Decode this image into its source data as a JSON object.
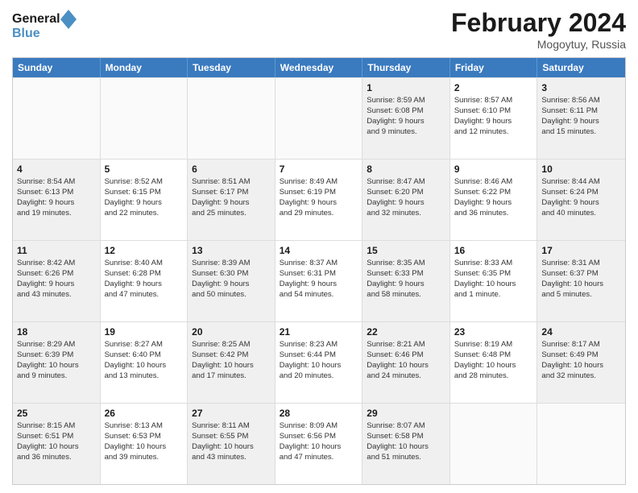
{
  "header": {
    "logo_general": "General",
    "logo_blue": "Blue",
    "main_title": "February 2024",
    "subtitle": "Mogoytuy, Russia"
  },
  "calendar": {
    "headers": [
      "Sunday",
      "Monday",
      "Tuesday",
      "Wednesday",
      "Thursday",
      "Friday",
      "Saturday"
    ],
    "rows": [
      [
        {
          "day": "",
          "content": ""
        },
        {
          "day": "",
          "content": ""
        },
        {
          "day": "",
          "content": ""
        },
        {
          "day": "",
          "content": ""
        },
        {
          "day": "1",
          "content": "Sunrise: 8:59 AM\nSunset: 6:08 PM\nDaylight: 9 hours\nand 9 minutes."
        },
        {
          "day": "2",
          "content": "Sunrise: 8:57 AM\nSunset: 6:10 PM\nDaylight: 9 hours\nand 12 minutes."
        },
        {
          "day": "3",
          "content": "Sunrise: 8:56 AM\nSunset: 6:11 PM\nDaylight: 9 hours\nand 15 minutes."
        }
      ],
      [
        {
          "day": "4",
          "content": "Sunrise: 8:54 AM\nSunset: 6:13 PM\nDaylight: 9 hours\nand 19 minutes."
        },
        {
          "day": "5",
          "content": "Sunrise: 8:52 AM\nSunset: 6:15 PM\nDaylight: 9 hours\nand 22 minutes."
        },
        {
          "day": "6",
          "content": "Sunrise: 8:51 AM\nSunset: 6:17 PM\nDaylight: 9 hours\nand 25 minutes."
        },
        {
          "day": "7",
          "content": "Sunrise: 8:49 AM\nSunset: 6:19 PM\nDaylight: 9 hours\nand 29 minutes."
        },
        {
          "day": "8",
          "content": "Sunrise: 8:47 AM\nSunset: 6:20 PM\nDaylight: 9 hours\nand 32 minutes."
        },
        {
          "day": "9",
          "content": "Sunrise: 8:46 AM\nSunset: 6:22 PM\nDaylight: 9 hours\nand 36 minutes."
        },
        {
          "day": "10",
          "content": "Sunrise: 8:44 AM\nSunset: 6:24 PM\nDaylight: 9 hours\nand 40 minutes."
        }
      ],
      [
        {
          "day": "11",
          "content": "Sunrise: 8:42 AM\nSunset: 6:26 PM\nDaylight: 9 hours\nand 43 minutes."
        },
        {
          "day": "12",
          "content": "Sunrise: 8:40 AM\nSunset: 6:28 PM\nDaylight: 9 hours\nand 47 minutes."
        },
        {
          "day": "13",
          "content": "Sunrise: 8:39 AM\nSunset: 6:30 PM\nDaylight: 9 hours\nand 50 minutes."
        },
        {
          "day": "14",
          "content": "Sunrise: 8:37 AM\nSunset: 6:31 PM\nDaylight: 9 hours\nand 54 minutes."
        },
        {
          "day": "15",
          "content": "Sunrise: 8:35 AM\nSunset: 6:33 PM\nDaylight: 9 hours\nand 58 minutes."
        },
        {
          "day": "16",
          "content": "Sunrise: 8:33 AM\nSunset: 6:35 PM\nDaylight: 10 hours\nand 1 minute."
        },
        {
          "day": "17",
          "content": "Sunrise: 8:31 AM\nSunset: 6:37 PM\nDaylight: 10 hours\nand 5 minutes."
        }
      ],
      [
        {
          "day": "18",
          "content": "Sunrise: 8:29 AM\nSunset: 6:39 PM\nDaylight: 10 hours\nand 9 minutes."
        },
        {
          "day": "19",
          "content": "Sunrise: 8:27 AM\nSunset: 6:40 PM\nDaylight: 10 hours\nand 13 minutes."
        },
        {
          "day": "20",
          "content": "Sunrise: 8:25 AM\nSunset: 6:42 PM\nDaylight: 10 hours\nand 17 minutes."
        },
        {
          "day": "21",
          "content": "Sunrise: 8:23 AM\nSunset: 6:44 PM\nDaylight: 10 hours\nand 20 minutes."
        },
        {
          "day": "22",
          "content": "Sunrise: 8:21 AM\nSunset: 6:46 PM\nDaylight: 10 hours\nand 24 minutes."
        },
        {
          "day": "23",
          "content": "Sunrise: 8:19 AM\nSunset: 6:48 PM\nDaylight: 10 hours\nand 28 minutes."
        },
        {
          "day": "24",
          "content": "Sunrise: 8:17 AM\nSunset: 6:49 PM\nDaylight: 10 hours\nand 32 minutes."
        }
      ],
      [
        {
          "day": "25",
          "content": "Sunrise: 8:15 AM\nSunset: 6:51 PM\nDaylight: 10 hours\nand 36 minutes."
        },
        {
          "day": "26",
          "content": "Sunrise: 8:13 AM\nSunset: 6:53 PM\nDaylight: 10 hours\nand 39 minutes."
        },
        {
          "day": "27",
          "content": "Sunrise: 8:11 AM\nSunset: 6:55 PM\nDaylight: 10 hours\nand 43 minutes."
        },
        {
          "day": "28",
          "content": "Sunrise: 8:09 AM\nSunset: 6:56 PM\nDaylight: 10 hours\nand 47 minutes."
        },
        {
          "day": "29",
          "content": "Sunrise: 8:07 AM\nSunset: 6:58 PM\nDaylight: 10 hours\nand 51 minutes."
        },
        {
          "day": "",
          "content": ""
        },
        {
          "day": "",
          "content": ""
        }
      ]
    ]
  }
}
